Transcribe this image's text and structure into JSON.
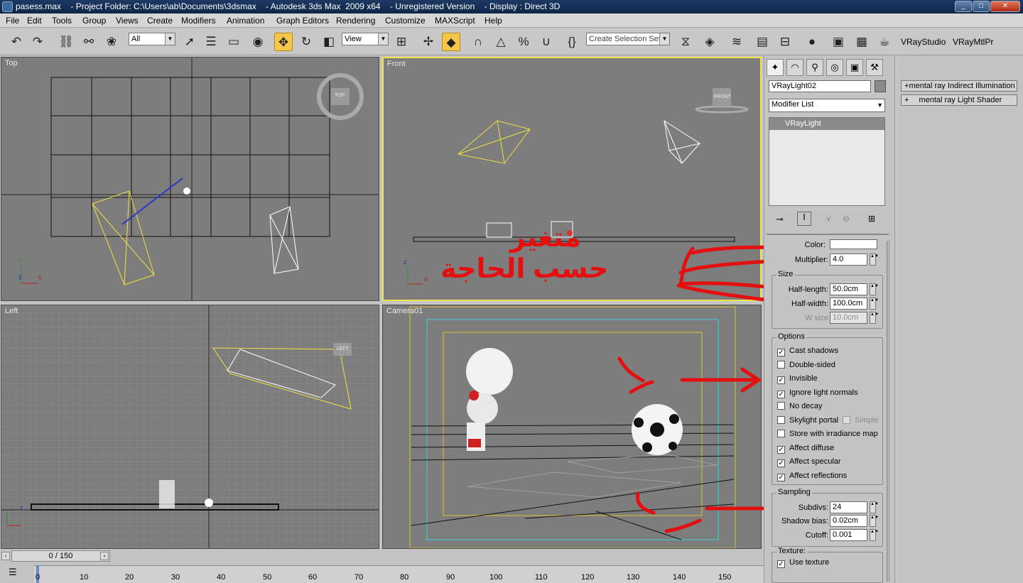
{
  "window": {
    "title": "pasess.max    - Project Folder: C:\\Users\\ab\\Documents\\3dsmax    - Autodesk 3ds Max  2009 x64    - Unregistered Version    - Display : Direct 3D",
    "controls": [
      "_",
      "□",
      "✕"
    ]
  },
  "menu": [
    "File",
    "Edit",
    "Tools",
    "Group",
    "Views",
    "Create",
    "Modifiers",
    "Animation",
    "Graph Editors",
    "Rendering",
    "Customize",
    "MAXScript",
    "Help"
  ],
  "toolbar": {
    "filter_value": "All",
    "refcoord_value": "View",
    "selection_set_placeholder": "Create Selection Set",
    "vray_studio": "VRayStudio",
    "vray_mtl": "VRayMtlPr"
  },
  "viewports": {
    "top": {
      "label": "Top",
      "cube": "TOP"
    },
    "front": {
      "label": "Front",
      "cube": "FRONT"
    },
    "left": {
      "label": "Left",
      "cube": "LEFT"
    },
    "camera": {
      "label": "Camera01"
    }
  },
  "axes": {
    "x": "x",
    "y": "y",
    "z": "z"
  },
  "annotations": {
    "word1": "متغير",
    "word2": "حسب الحاجة"
  },
  "command_panel": {
    "object_name": "VRayLight02",
    "modifier_list": "Modifier List",
    "stack_item": "VRayLight",
    "color_label": "Color:",
    "multiplier_label": "Multiplier:",
    "multiplier_value": "4.0",
    "size_group": "Size",
    "half_length_label": "Half-length:",
    "half_length_value": "50.0cm",
    "half_width_label": "Half-width:",
    "half_width_value": "100.0cm",
    "w_size_label": "W size",
    "w_size_value": "10.0cm",
    "options_group": "Options",
    "options": [
      {
        "label": "Cast shadows",
        "checked": true
      },
      {
        "label": "Double-sided",
        "checked": false
      },
      {
        "label": "Invisible",
        "checked": true
      },
      {
        "label": "Ignore light normals",
        "checked": true
      },
      {
        "label": "No decay",
        "checked": false
      },
      {
        "label": "Skylight portal",
        "checked": false
      },
      {
        "label": "Store with irradiance map",
        "checked": false
      },
      {
        "label": "Affect diffuse",
        "checked": true
      },
      {
        "label": "Affect specular",
        "checked": true
      },
      {
        "label": "Affect reflections",
        "checked": true
      }
    ],
    "simple_label": "Simple",
    "sampling_group": "Sampling",
    "subdivs_label": "Subdivs:",
    "subdivs_value": "24",
    "shadow_bias_label": "Shadow bias:",
    "shadow_bias_value": "0.02cm",
    "cutoff_label": "Cutoff:",
    "cutoff_value": "0.001",
    "texture_group": "Texture:",
    "use_texture_label": "Use texture",
    "use_texture_checked": true
  },
  "right_panel": {
    "btn1": "mental ray Indirect Illumination",
    "btn2": "mental ray Light Shader",
    "btn1_glyph": "+",
    "btn2_glyph": "+"
  },
  "timeline": {
    "slider_text": "0 / 150",
    "ticks": [
      "0",
      "10",
      "20",
      "30",
      "40",
      "50",
      "60",
      "70",
      "80",
      "90",
      "100",
      "110",
      "120",
      "130",
      "140",
      "150"
    ]
  }
}
